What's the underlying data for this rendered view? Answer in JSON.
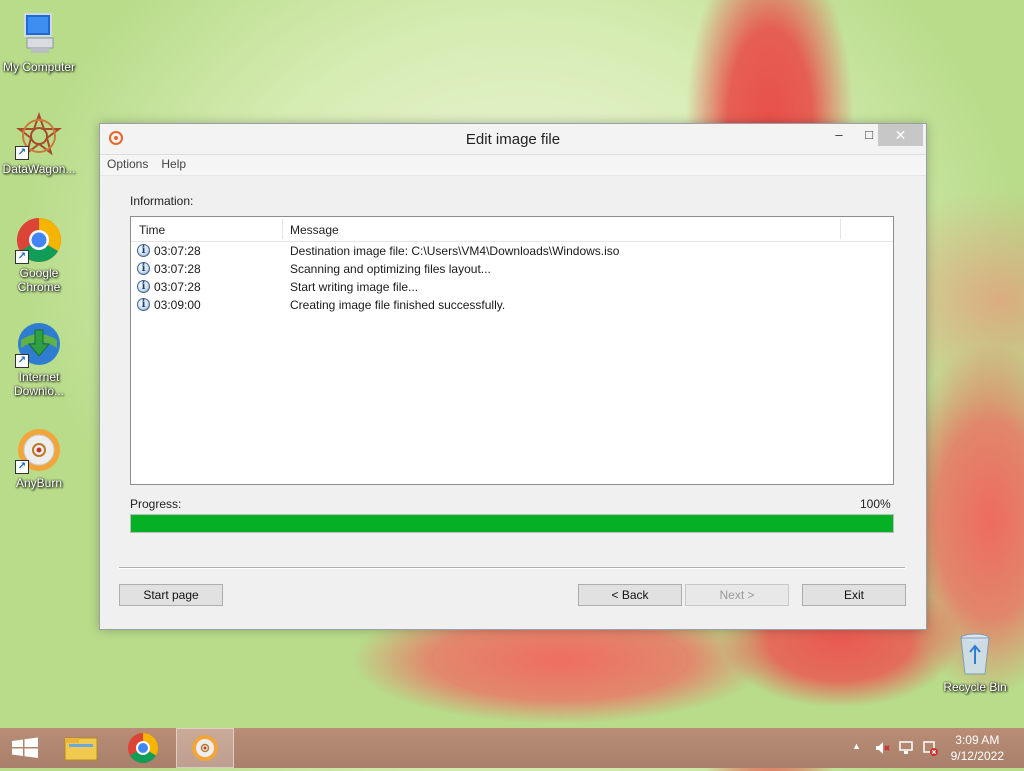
{
  "desktop": {
    "icons": [
      {
        "label": "My Computer"
      },
      {
        "label": "DataWagon..."
      },
      {
        "label": "Google Chrome"
      },
      {
        "label": "Internet Downlo..."
      },
      {
        "label": "AnyBurn"
      },
      {
        "label": "Recycle Bin"
      }
    ]
  },
  "window": {
    "title": "Edit image file",
    "menu": [
      "Options",
      "Help"
    ],
    "info_label": "Information:",
    "columns": {
      "time": "Time",
      "message": "Message"
    },
    "log": [
      {
        "time": "03:07:28",
        "message": "Destination image file:  C:\\Users\\VM4\\Downloads\\Windows.iso"
      },
      {
        "time": "03:07:28",
        "message": "Scanning and optimizing files layout..."
      },
      {
        "time": "03:07:28",
        "message": "Start writing image file..."
      },
      {
        "time": "03:09:00",
        "message": "Creating image file finished successfully."
      }
    ],
    "progress_label": "Progress:",
    "progress_text": "100%",
    "progress_value": 1.0,
    "buttons": {
      "start_page": "Start page",
      "back": "< Back",
      "next": "Next >",
      "exit": "Exit"
    },
    "controls": {
      "minimize": "–",
      "maximize": "□",
      "close": "✕"
    }
  },
  "taskbar": {
    "clock_time": "3:09 AM",
    "clock_date": "9/12/2022",
    "tray_icons": [
      "chevron-up-icon",
      "speaker-muted-icon",
      "network-icon",
      "action-center-icon"
    ]
  },
  "colors": {
    "progress_fill": "#06b025",
    "taskbar": "#b08570"
  }
}
